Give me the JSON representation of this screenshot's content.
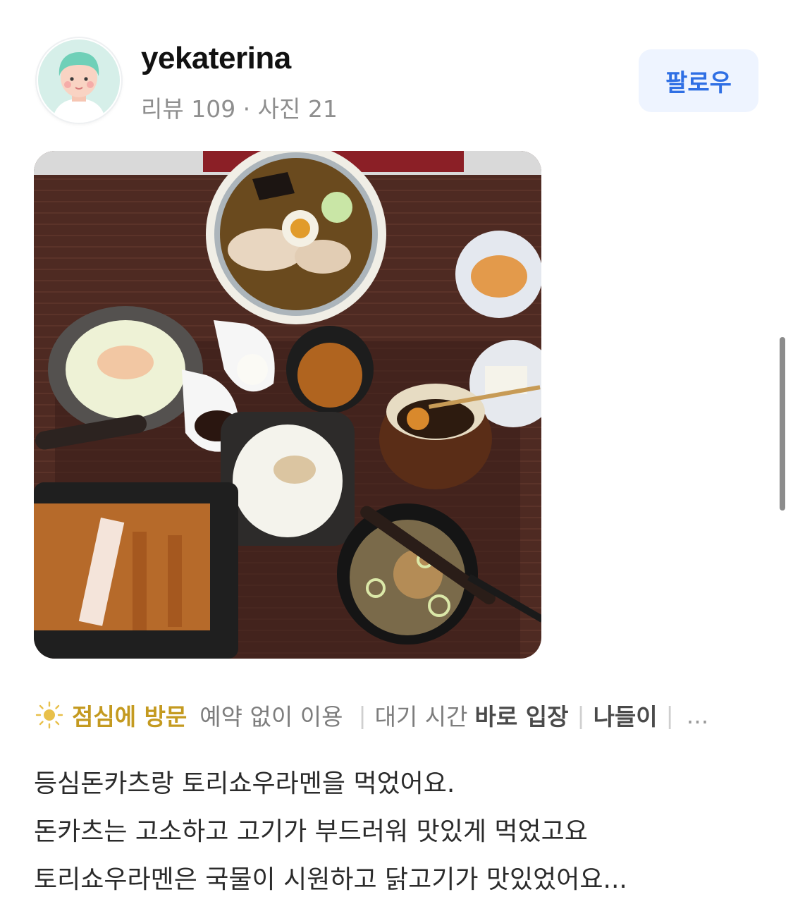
{
  "profile": {
    "username": "yekaterina",
    "stats": "리뷰 109 · 사진 21",
    "follow_label": "팔로우"
  },
  "visit_info": {
    "icon": "sun-icon",
    "time": "점심에 방문",
    "items": [
      {
        "key": "예약 없이 이용",
        "value": ""
      },
      {
        "key": "대기 시간",
        "value": "바로 입장"
      },
      {
        "key": "",
        "value": "나들이"
      }
    ],
    "more": "..."
  },
  "review": {
    "lines": [
      "등심돈카츠랑 토리쇼우라멘을 먹었어요.",
      "돈카츠는 고소하고 고기가 부드러워 맛있게 먹었고요",
      "토리쇼우라멘은 국물이 시원하고 닭고기가 맛있었어요..."
    ]
  },
  "colors": {
    "accent_blue": "#2f6fe4",
    "follow_bg": "#eef4ff",
    "visit_time": "#c49a20"
  }
}
